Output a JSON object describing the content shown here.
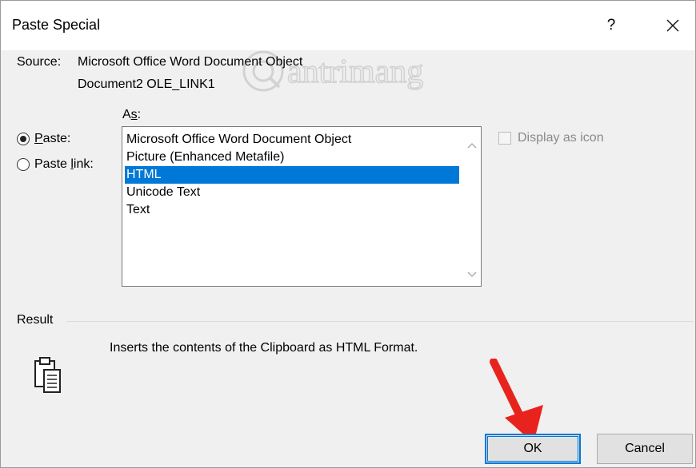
{
  "window": {
    "title": "Paste Special",
    "help_label": "?"
  },
  "watermark": {
    "text": "Quantrimang"
  },
  "source": {
    "label": "Source:",
    "value": "Microsoft Office Word Document Object",
    "link": "Document2 OLE_LINK1"
  },
  "as": {
    "label_prefix": "A",
    "label_accel": "s",
    "label_suffix": ":"
  },
  "paste_options": {
    "paste": {
      "prefix": "",
      "accel": "P",
      "suffix": "aste:",
      "checked": true
    },
    "paste_link": {
      "prefix": "Paste ",
      "accel": "l",
      "suffix": "ink:",
      "checked": false
    }
  },
  "formats": {
    "items": [
      "Microsoft Office Word Document Object",
      "Picture (Enhanced Metafile)",
      "HTML",
      "Unicode Text",
      "Text"
    ],
    "selected_index": 2
  },
  "display_as_icon": {
    "label": "Display as icon",
    "checked": false,
    "enabled": false
  },
  "result": {
    "label": "Result",
    "text": "Inserts the contents of the Clipboard as HTML Format."
  },
  "buttons": {
    "ok_label": "OK",
    "cancel_label": "Cancel"
  },
  "colors": {
    "selection": "#0078d7",
    "dialog_background": "#f0f0f0",
    "annotation_arrow": "#e8231d"
  }
}
